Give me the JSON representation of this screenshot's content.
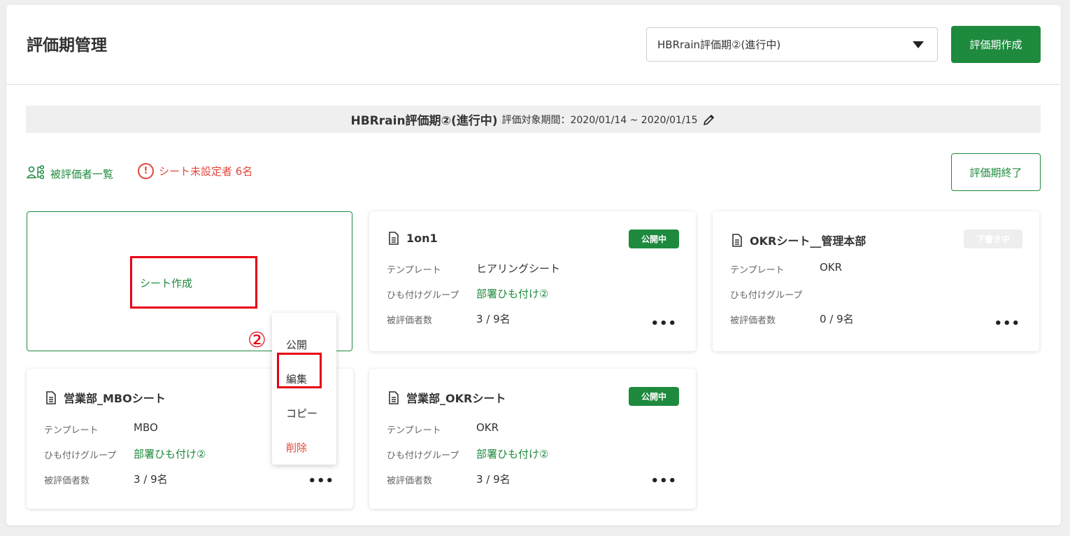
{
  "header": {
    "title": "評価期管理",
    "period_select_value": "HBRrain評価期②(進行中)",
    "create_period_button": "評価期作成"
  },
  "banner": {
    "period_name": "HBRrain評価期②(進行中)",
    "period_range": "評価対象期間：2020/01/14 ~ 2020/01/15"
  },
  "links": {
    "evaluee_list": "被評価者一覧",
    "unassigned_warning": "シート未設定者 6名",
    "warning_glyph": "!"
  },
  "end_period_button": "評価期終了",
  "create_sheet_label": "シート作成",
  "annotation_step": "②",
  "cards": [
    {
      "title": "1on1",
      "status": "公開中",
      "template_label": "テンプレート",
      "template_value": "ヒアリングシート",
      "group_label": "ひも付けグループ",
      "group_value": "部署ひも付け②",
      "count_label": "被評価者数",
      "count_value": "3 / 9名"
    },
    {
      "title": "OKRシート__管理本部",
      "status": "下書き中",
      "template_label": "テンプレート",
      "template_value": "OKR",
      "group_label": "ひも付けグループ",
      "group_value": "",
      "count_label": "被評価者数",
      "count_value": "0 / 9名"
    },
    {
      "title": "営業部_MBOシート",
      "status": "",
      "template_label": "テンプレート",
      "template_value": "MBO",
      "group_label": "ひも付けグループ",
      "group_value": "部署ひも付け②",
      "count_label": "被評価者数",
      "count_value": "3 / 9名"
    },
    {
      "title": "営業部_OKRシート",
      "status": "公開中",
      "template_label": "テンプレート",
      "template_value": "OKR",
      "group_label": "ひも付けグループ",
      "group_value": "部署ひも付け②",
      "count_label": "被評価者数",
      "count_value": "3 / 9名"
    }
  ],
  "more_glyph": "•••",
  "context_menu": {
    "items": [
      "公開",
      "編集",
      "コピー",
      "削除"
    ]
  },
  "colors": {
    "accent_green": "#1e8a3e",
    "danger_red": "#e0473b",
    "annotation_red": "#e60012"
  },
  "icons": {
    "dropdown": "caret-down-icon",
    "edit": "pencil-icon",
    "evaluees": "people-network-icon",
    "warning": "exclamation-circle-icon",
    "document": "document-icon",
    "more": "more-horizontal-icon"
  }
}
